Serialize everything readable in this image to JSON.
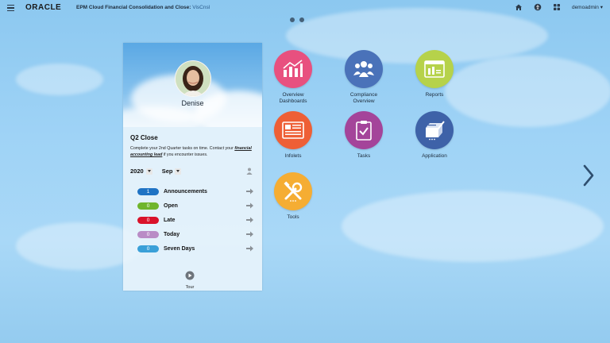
{
  "header": {
    "logo": "ORACLE",
    "app_title": "EPM Cloud Financial Consolidation and Close: ",
    "tenant": "VisCnsl",
    "user": "demoadmin ▾"
  },
  "panel": {
    "user_name": "Denise",
    "title": "Q2 Close",
    "desc_part1": "Complete your 2nd Quarter tasks on time.  Contact your ",
    "desc_link": "financial accounting lead",
    "desc_part2": "  if you encounter issues.",
    "year": "2020",
    "month": "Sep",
    "tasks": [
      {
        "count": "1",
        "label": "Announcements",
        "color": "#1f73c4"
      },
      {
        "count": "0",
        "label": "Open",
        "color": "#6fb52c"
      },
      {
        "count": "0",
        "label": "Late",
        "color": "#d9122a"
      },
      {
        "count": "0",
        "label": "Today",
        "color": "#b98cc6"
      },
      {
        "count": "0",
        "label": "Seven Days",
        "color": "#3aa0d8"
      }
    ],
    "tour_label": "Tour"
  },
  "tiles": {
    "overview_dashboards": "Overview\nDashboards",
    "compliance_overview": "Compliance\nOverview",
    "reports": "Reports",
    "infolets": "Infolets",
    "tasks": "Tasks",
    "application": "Application",
    "tools": "Tools"
  },
  "colors": {
    "pink": "#e8507f",
    "blue": "#4a72b9",
    "lime": "#b6d24a",
    "orange": "#ee5f36",
    "purple": "#a4449a",
    "navy": "#3e62a8",
    "yellow": "#f5ad33"
  }
}
